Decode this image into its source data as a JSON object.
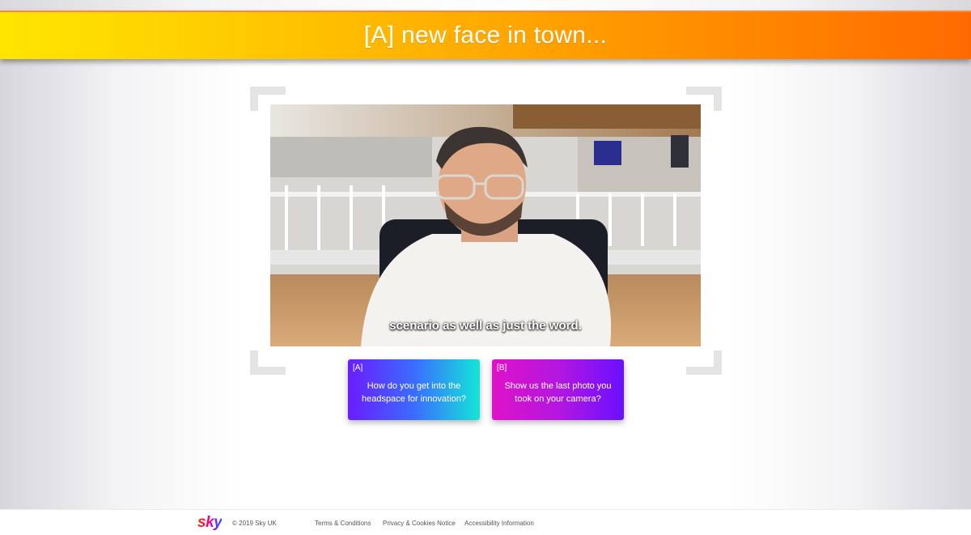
{
  "header": {
    "title": "[A] new face in town..."
  },
  "video": {
    "subtitle": "scenario as well as just the word."
  },
  "answers": [
    {
      "letter": "[A]",
      "text": "How do you get into the headspace for innovation?"
    },
    {
      "letter": "[B]",
      "text": "Show us the last photo you took on your camera?"
    }
  ],
  "footer": {
    "logo": "sky",
    "copyright": "© 2019 Sky UK",
    "links": [
      "Terms & Conditions",
      "Privacy & Cookies Notice",
      "Accessibility Information"
    ]
  },
  "colors": {
    "banner_start": "#ffe600",
    "banner_end": "#ff6a00",
    "card_a_start": "#6a1cff",
    "card_a_end": "#12e6d6",
    "card_b_start": "#e012c8",
    "card_b_end": "#6a10ff"
  }
}
